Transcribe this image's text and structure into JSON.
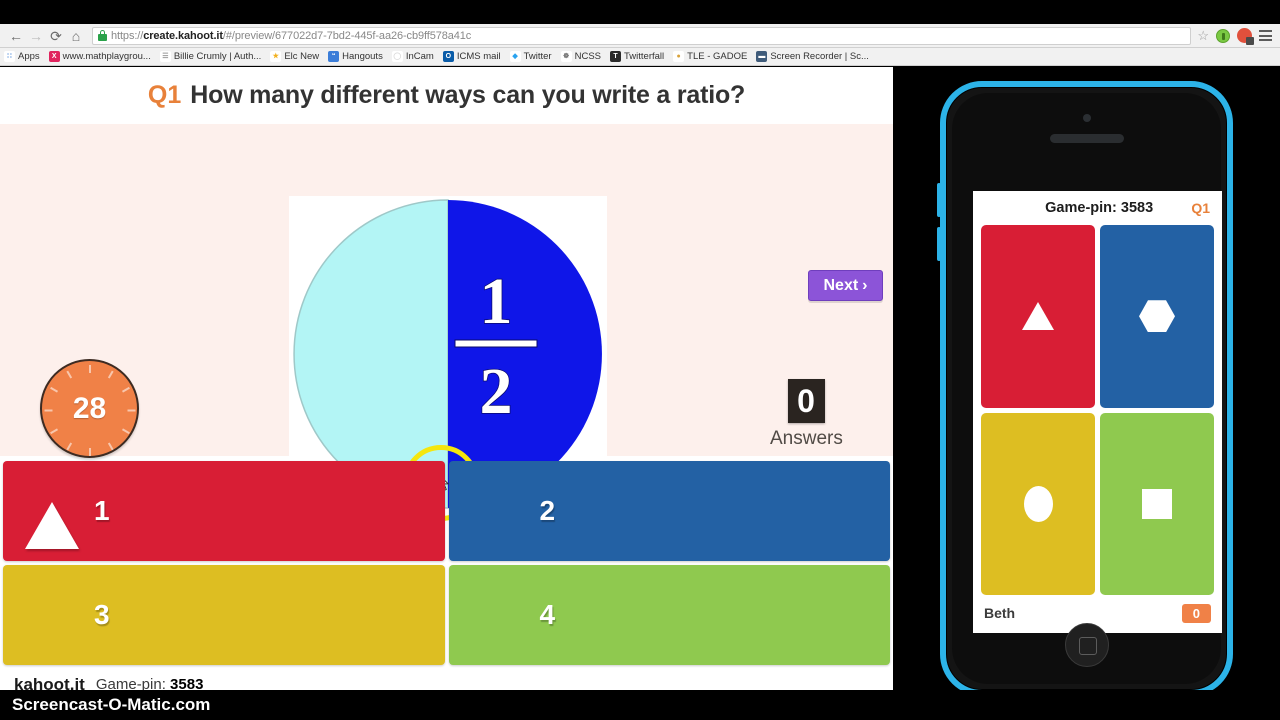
{
  "browser": {
    "back_icon": "←",
    "forward_icon": "→",
    "reload_icon": "⟳",
    "home_icon": "⌂",
    "url_prefix": "https://",
    "url_domain": "create.kahoot.it",
    "url_path": "/#/preview/677022d7-7bd2-445f-aa26-cb9ff578a41c",
    "star_icon": "☆",
    "bookmarks": [
      {
        "label": "Apps",
        "ico": "∷",
        "color": "#ffffff",
        "fg": "#4a88d8"
      },
      {
        "label": "www.mathplaygrou...",
        "ico": "X",
        "color": "#e0245e",
        "fg": "#ffffff"
      },
      {
        "label": "Billie Crumly | Auth...",
        "ico": "☰",
        "color": "#ffffff",
        "fg": "#9a9a9a"
      },
      {
        "label": "Elc New",
        "ico": "★",
        "color": "#ffffff",
        "fg": "#f2b01e"
      },
      {
        "label": "Hangouts",
        "ico": "“",
        "color": "#3b7dd8",
        "fg": "#ffffff"
      },
      {
        "label": "InCam",
        "ico": "◯",
        "color": "#ffffff",
        "fg": "#d9d9d9"
      },
      {
        "label": "ICMS mail",
        "ico": "O",
        "color": "#0a5ca8",
        "fg": "#ffffff"
      },
      {
        "label": "Twitter",
        "ico": "◆",
        "color": "#ffffff",
        "fg": "#2aa3ef"
      },
      {
        "label": "NCSS",
        "ico": "☸",
        "color": "#ffffff",
        "fg": "#6b6b6b"
      },
      {
        "label": "Twitterfall",
        "ico": "T",
        "color": "#2b2b2b",
        "fg": "#ffffff"
      },
      {
        "label": "TLE - GADOE",
        "ico": "●",
        "color": "#ffffff",
        "fg": "#d8a23a"
      },
      {
        "label": "Screen Recorder | Sc...",
        "ico": "▬",
        "color": "#3f5b7a",
        "fg": "#ffffff"
      }
    ]
  },
  "quiz": {
    "question_number": "Q1",
    "question_text": "How many different ways can you write a ratio?",
    "timer_seconds": "28",
    "answers_count": "0",
    "answers_label": "Answers",
    "next_label": "Next",
    "next_chevron": "›",
    "media": {
      "alt": "circle-half-shaded-one-half",
      "numerator": "1",
      "denominator": "2",
      "left_color": "#b3f5f5",
      "right_color": "#0f16e8"
    },
    "options": [
      {
        "label": "1",
        "shape": "triangle",
        "color": "#d81e35"
      },
      {
        "label": "2",
        "shape": "hexagon",
        "color": "#2361a4"
      },
      {
        "label": "3",
        "shape": "circle",
        "color": "#ddbe22"
      },
      {
        "label": "4",
        "shape": "square",
        "color": "#8fc94f"
      }
    ],
    "footer_brand": "kahoot.it",
    "footer_gamepin_label": "Game-pin:",
    "footer_gamepin": "3583"
  },
  "phone": {
    "gamepin_text": "Game-pin: 3583",
    "question_number": "Q1",
    "tiles": [
      {
        "shape": "triangle",
        "color": "#d81e35"
      },
      {
        "shape": "hexagon",
        "color": "#2361a4"
      },
      {
        "shape": "circle",
        "color": "#ddbe22"
      },
      {
        "shape": "square",
        "color": "#8fc94f"
      }
    ],
    "player_name": "Beth",
    "player_score": "0",
    "case_color": "#2cb3e8"
  },
  "watermark": {
    "text": "Screencast-O-Matic.com"
  }
}
